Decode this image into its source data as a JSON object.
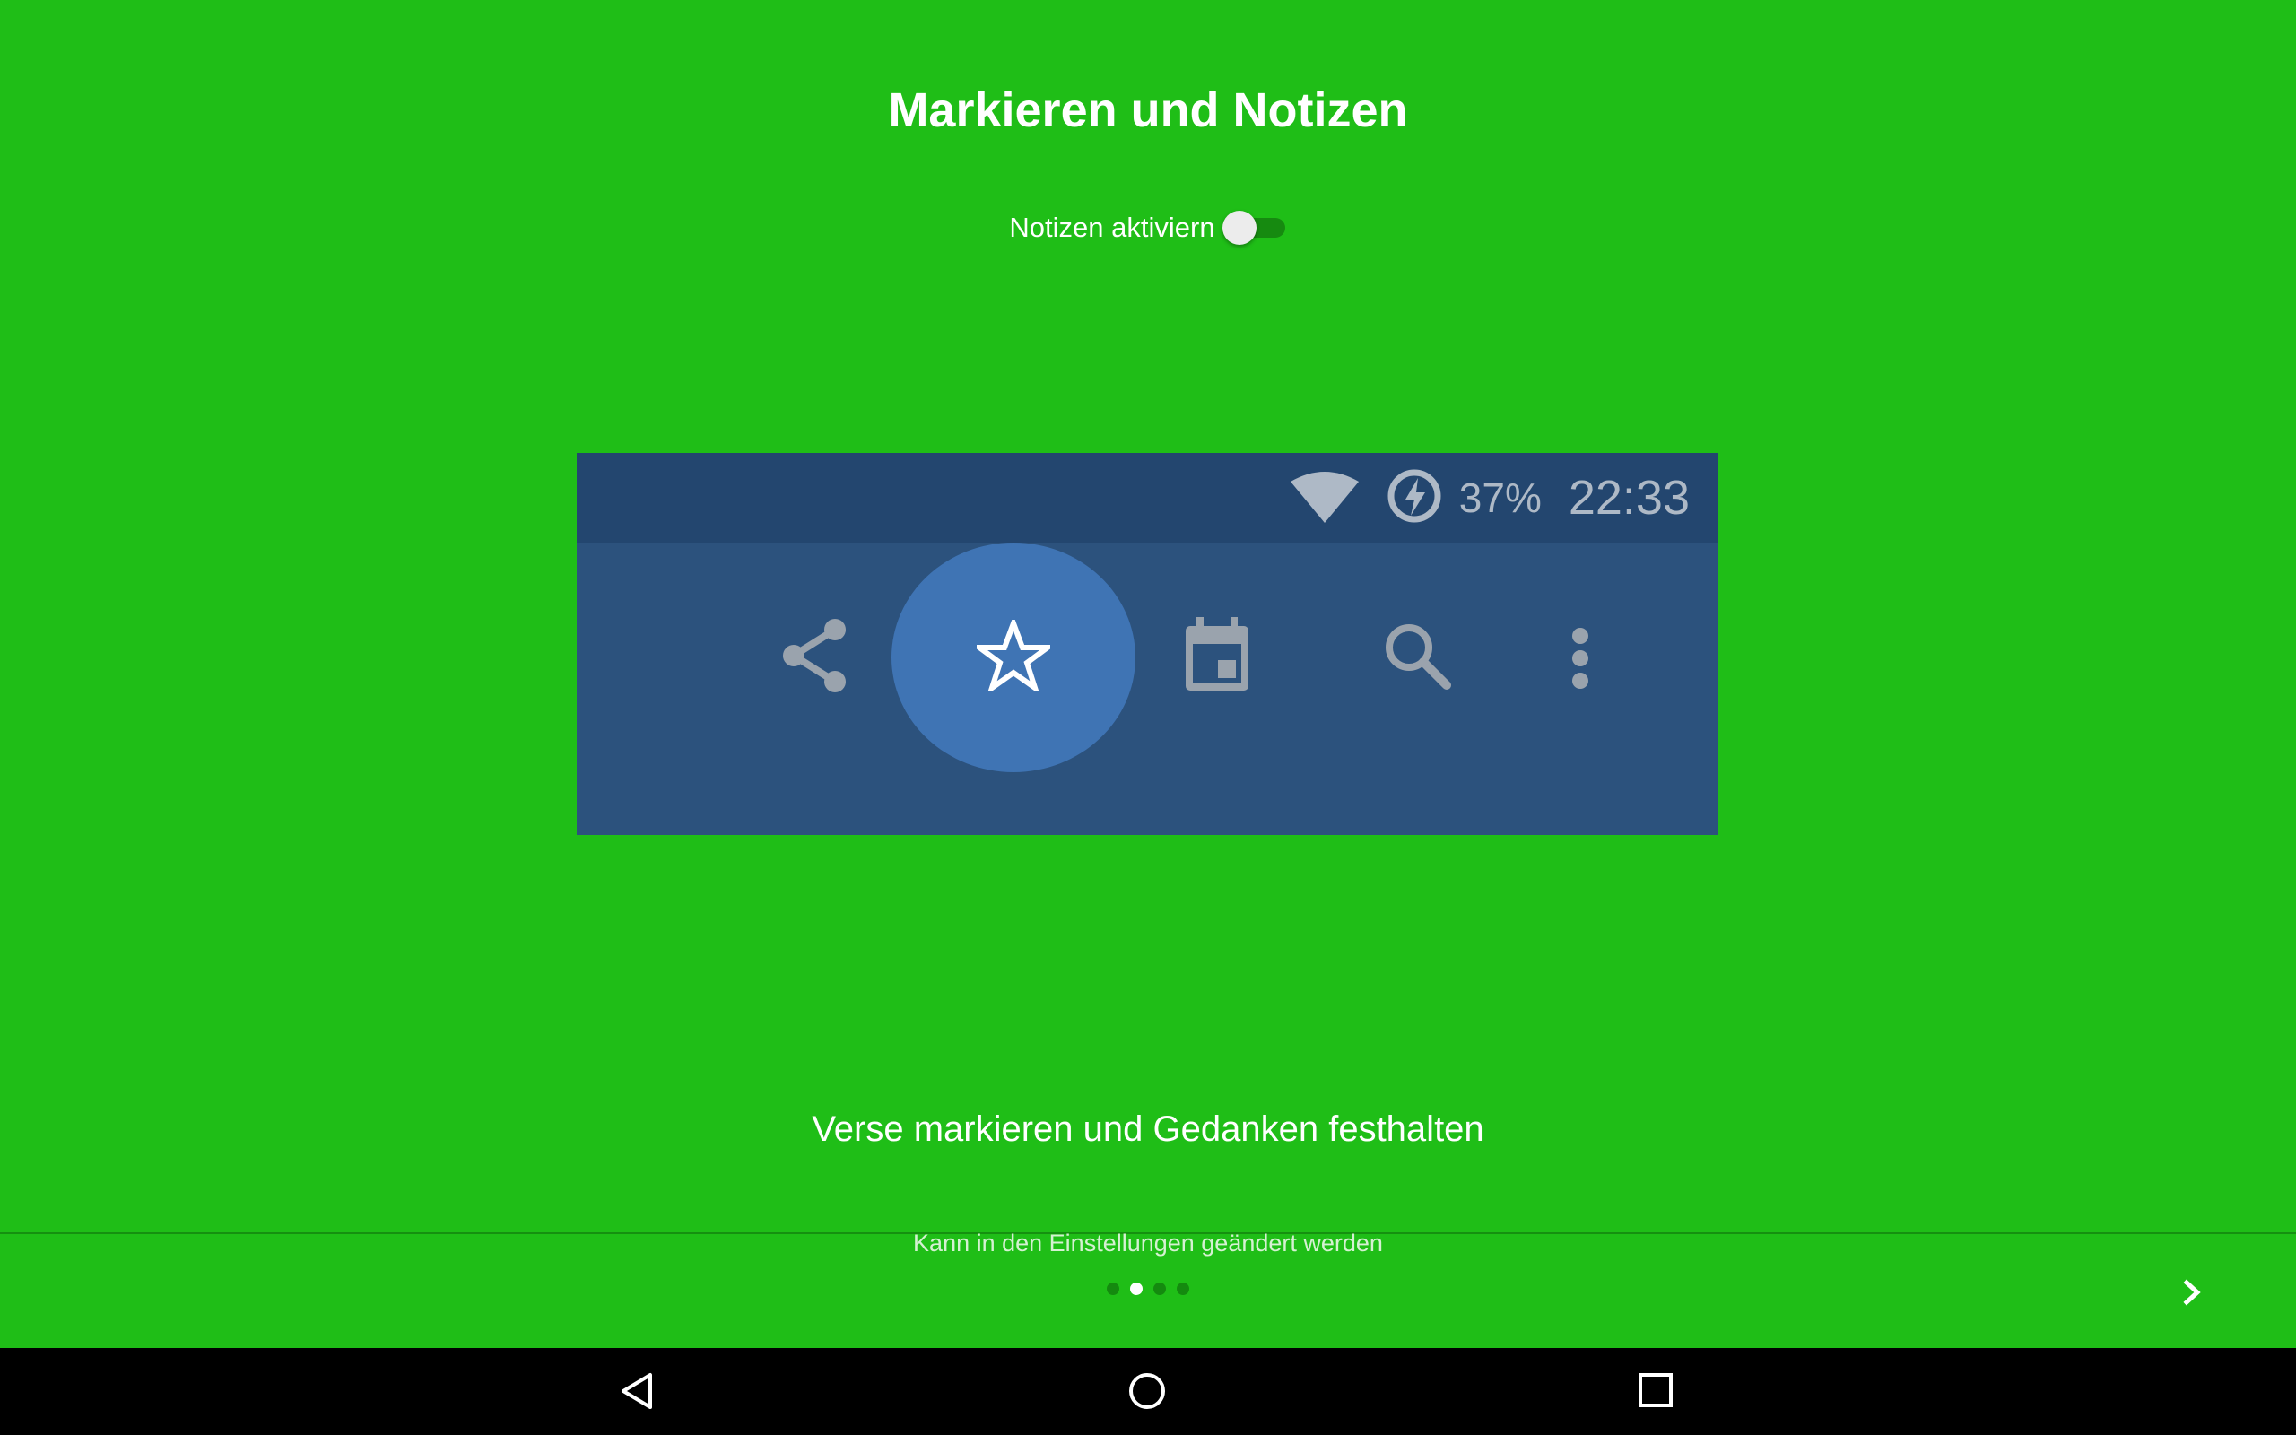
{
  "header": {
    "title": "Markieren und Notizen"
  },
  "toggle": {
    "label": "Notizen aktiviern",
    "checked": false
  },
  "preview": {
    "status_bar": {
      "battery": "37%",
      "time": "22:33",
      "icons": [
        "wifi-icon",
        "battery-saver-icon"
      ]
    },
    "toolbar_icons": [
      "share-icon",
      "star-icon",
      "calendar-icon",
      "search-icon",
      "more-vert-icon"
    ],
    "highlighted_icon": "star-icon"
  },
  "body": {
    "subtitle": "Verse markieren und Gedanken festhalten"
  },
  "footer": {
    "hint": "Kann in den Einstellungen geändert werden",
    "page_indicator": {
      "total": 4,
      "current": 2
    },
    "next_icon": "chevron-right-icon"
  },
  "navbar": {
    "icons": [
      "back-icon",
      "home-icon",
      "recents-icon"
    ]
  },
  "colors": {
    "background": "#1fbe17",
    "preview_background": "#2c527d",
    "preview_statusbar": "#23466f",
    "highlight": "#3f74b4",
    "icon_gray": "#9aa3ad",
    "navbar": "#000000"
  }
}
